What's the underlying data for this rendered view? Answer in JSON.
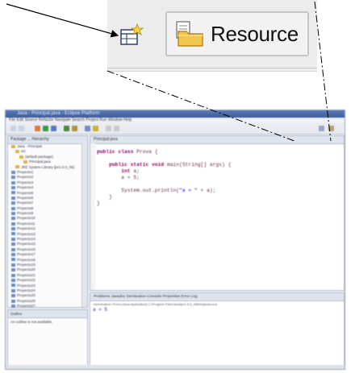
{
  "zoom_toolbar": {
    "open_perspective_icon": "open-perspective-icon",
    "perspective_icon": "resource-folder-icon",
    "perspective_label": "Resource"
  },
  "window": {
    "title": "Java - Principal.java - Eclipse Platform",
    "menu": "File  Edit  Source  Refactor  Navigate  Search  Project  Run  Window  Help",
    "left_tabs": "Package ...   Hierarchy",
    "tree_items": [
      "Java - Principal",
      "src",
      "(default package)",
      "Principal.java",
      "JRE System Library [jre1.5.0_06]",
      "Proyecto1",
      "Proyecto2",
      "Proyecto3",
      "Proyecto4",
      "Proyecto5",
      "Proyecto6",
      "Proyecto7",
      "Proyecto8",
      "Proyecto9",
      "Proyecto10",
      "Proyecto11",
      "Proyecto12",
      "Proyecto13",
      "Proyecto14",
      "Proyecto15",
      "Proyecto16",
      "Proyecto17",
      "Proyecto18",
      "Proyecto19",
      "Proyecto20",
      "Proyecto21",
      "Proyecto22",
      "Proyecto23",
      "Proyecto24",
      "Proyecto25",
      "Proyecto26",
      "Proyecto27"
    ],
    "outline_tab": "Outline",
    "outline_text": "An outline is not available.",
    "editor_tab": "Principal.java",
    "code_lines": [
      "public class Prova {",
      "",
      "    public static void main(String[] args) {",
      "        int a;",
      "        a = 5;",
      "",
      "        System.out.println(\"a = \" + a);",
      "    }",
      "}"
    ],
    "console_tabs": "Problems   Javadoc   Declaration   Console   Properties   Error Log",
    "console_header": "<terminated> Prova [Java Application] C:\\Program Files\\Java\\jre1.5.0_06\\bin\\javaw.exe",
    "console_output": "a = 5"
  },
  "colors": {
    "accent_title": "#4a6aa9",
    "keyword": "#7f0055",
    "string": "#2a00ff"
  }
}
